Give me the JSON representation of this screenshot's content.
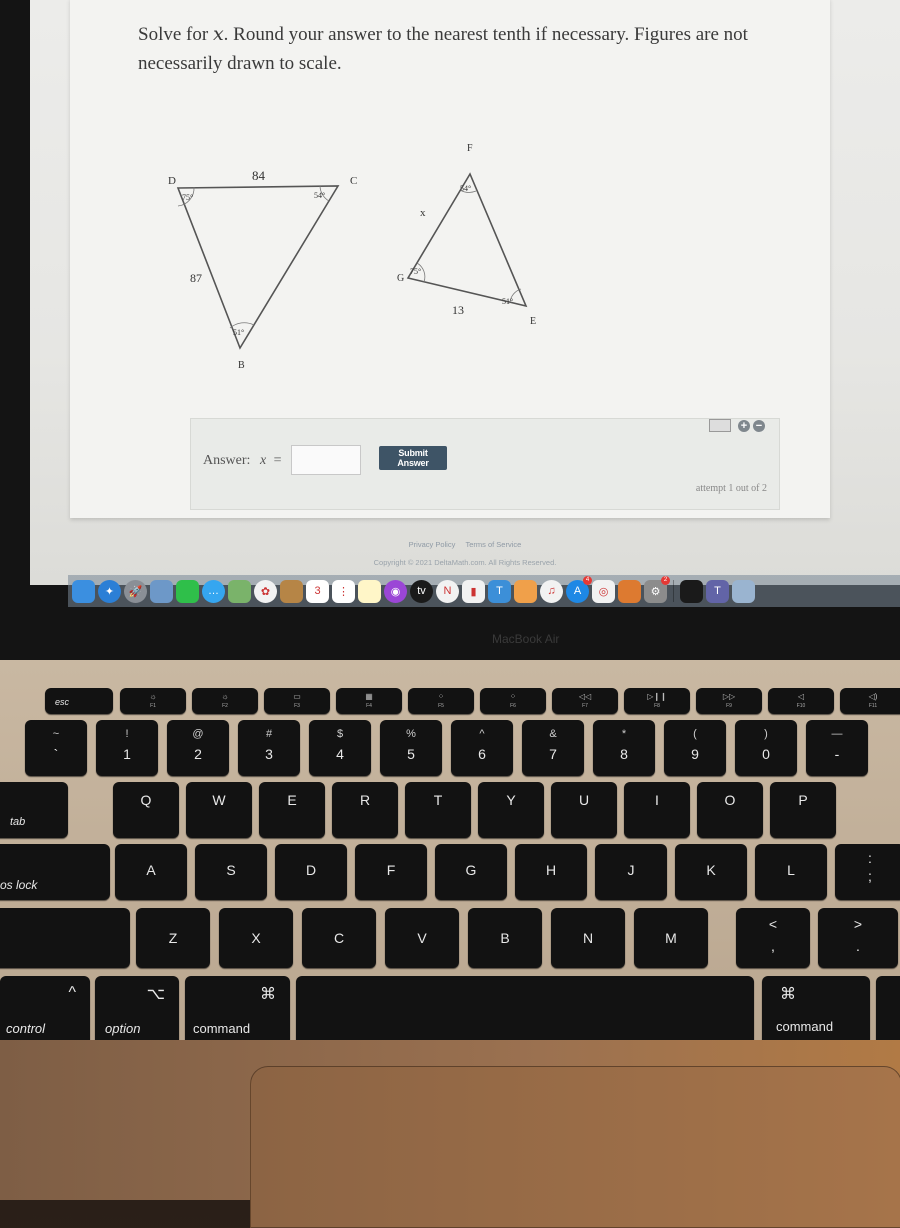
{
  "problem": {
    "prompt_prefix": "Solve for ",
    "variable": "x",
    "prompt_suffix": ". Round your answer to the nearest tenth if necessary. Figures are not necessarily drawn to scale."
  },
  "figures": {
    "triangle_1": {
      "vertices": {
        "D": "D",
        "C": "C",
        "B": "B"
      },
      "angles": {
        "D": "75°",
        "C": "54°",
        "B": "51°"
      },
      "sides": {
        "DC": "84",
        "DB": "87"
      }
    },
    "triangle_2": {
      "vertices": {
        "F": "F",
        "G": "G",
        "E": "E"
      },
      "angles": {
        "F": "54°",
        "G": "75°",
        "E": "51°"
      },
      "sides": {
        "GF": "x",
        "GE": "13"
      }
    }
  },
  "answer": {
    "label": "Answer:",
    "variable": "x",
    "equals": "=",
    "input_value": "",
    "submit_label": "Submit Answer",
    "attempt_text": "attempt 1 out of 2"
  },
  "footer": {
    "privacy": "Privacy Policy",
    "terms": "Terms of Service",
    "copyright": "Copyright © 2021 DeltaMath.com. All Rights Reserved."
  },
  "dock": {
    "apps": [
      {
        "name": "finder",
        "color": "#3b8fe0",
        "glyph": ""
      },
      {
        "name": "safari",
        "color": "#2b7fd6",
        "glyph": "✦"
      },
      {
        "name": "launchpad",
        "color": "#8a8f96",
        "glyph": "🚀"
      },
      {
        "name": "preview",
        "color": "#6d98c8",
        "glyph": ""
      },
      {
        "name": "facetime",
        "color": "#2fbf4a",
        "glyph": ""
      },
      {
        "name": "messages",
        "color": "#35a6f0",
        "glyph": "…"
      },
      {
        "name": "maps",
        "color": "#7ab36a",
        "glyph": ""
      },
      {
        "name": "photos",
        "color": "#f2f2f2",
        "glyph": "✿"
      },
      {
        "name": "contacts",
        "color": "#b68546",
        "glyph": ""
      },
      {
        "name": "calendar",
        "color": "#ffffff",
        "glyph": "3"
      },
      {
        "name": "reminders",
        "color": "#ffffff",
        "glyph": "⋮"
      },
      {
        "name": "notes",
        "color": "#fff6c8",
        "glyph": ""
      },
      {
        "name": "podcasts",
        "color": "#9b46d6",
        "glyph": "◉"
      },
      {
        "name": "apple-tv",
        "color": "#1a1a1a",
        "glyph": "tv"
      },
      {
        "name": "news",
        "color": "#f2f2f2",
        "glyph": "N"
      },
      {
        "name": "numbers",
        "color": "#f2f2f2",
        "glyph": "▮"
      },
      {
        "name": "keynote",
        "color": "#3c8fd8",
        "glyph": "T"
      },
      {
        "name": "pages",
        "color": "#f0a04a",
        "glyph": ""
      },
      {
        "name": "music",
        "color": "#f2f2f2",
        "glyph": "♫"
      },
      {
        "name": "app-store",
        "color": "#1e88e5",
        "glyph": "A",
        "badge": "4"
      },
      {
        "name": "chrome",
        "color": "#f2f2f2",
        "glyph": "◎"
      },
      {
        "name": "books-panel",
        "color": "#dd7a30",
        "glyph": ""
      },
      {
        "name": "system-preferences",
        "color": "#8c8c8c",
        "glyph": "⚙",
        "badge": "2"
      },
      {
        "name": "webex",
        "color": "#1a1a1a",
        "glyph": ""
      },
      {
        "name": "teams",
        "color": "#6264a7",
        "glyph": "T"
      },
      {
        "name": "photo-app",
        "color": "#9ab4d0",
        "glyph": ""
      }
    ]
  },
  "device_label": "MacBook Air",
  "keyboard": {
    "fn_row": [
      {
        "label": "esc",
        "icon": ""
      },
      {
        "label": "F1",
        "icon": "☼"
      },
      {
        "label": "F2",
        "icon": "☼"
      },
      {
        "label": "F3",
        "icon": "▭"
      },
      {
        "label": "F4",
        "icon": "▦"
      },
      {
        "label": "F5",
        "icon": "⁘"
      },
      {
        "label": "F6",
        "icon": "⁘"
      },
      {
        "label": "F7",
        "icon": "◁◁"
      },
      {
        "label": "F8",
        "icon": "▷❙❙"
      },
      {
        "label": "F9",
        "icon": "▷▷"
      },
      {
        "label": "F10",
        "icon": "◁"
      },
      {
        "label": "F11",
        "icon": "◁)"
      }
    ],
    "number_row": [
      {
        "top": "~",
        "main": "`"
      },
      {
        "top": "!",
        "main": "1"
      },
      {
        "top": "@",
        "main": "2"
      },
      {
        "top": "#",
        "main": "3"
      },
      {
        "top": "$",
        "main": "4"
      },
      {
        "top": "%",
        "main": "5"
      },
      {
        "top": "^",
        "main": "6"
      },
      {
        "top": "&",
        "main": "7"
      },
      {
        "top": "*",
        "main": "8"
      },
      {
        "top": "(",
        "main": "9"
      },
      {
        "top": ")",
        "main": "0"
      },
      {
        "top": "—",
        "main": "-"
      }
    ],
    "qwerty_row": [
      "Q",
      "W",
      "E",
      "R",
      "T",
      "Y",
      "U",
      "I",
      "O",
      "P"
    ],
    "home_row": [
      "A",
      "S",
      "D",
      "F",
      "G",
      "H",
      "J",
      "K",
      "L"
    ],
    "bottom_row": [
      "Z",
      "X",
      "C",
      "V",
      "B",
      "N",
      "M"
    ],
    "punct": {
      "comma_top": "<",
      "comma": ",",
      "period_top": ">",
      "period": ".",
      "semicolon_top": ":",
      "semicolon": ";"
    },
    "mods": {
      "tab": "tab",
      "caps": "os lock",
      "control": "control",
      "control_sym": "^",
      "option": "option",
      "option_sym": "⌥",
      "command": "command",
      "command_sym": "⌘",
      "command_r": "command",
      "command_r_sym": "⌘"
    }
  }
}
